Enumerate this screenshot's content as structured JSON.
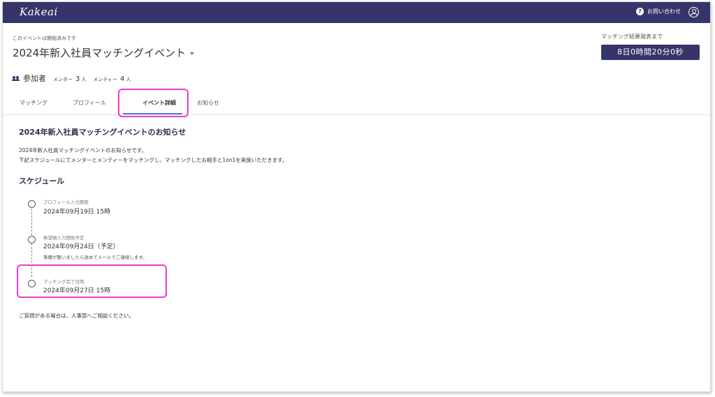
{
  "app": {
    "logo": "Kakeai"
  },
  "header": {
    "help_label": "お問い合わせ",
    "help_icon": "question-icon",
    "account_icon": "account-circle-icon"
  },
  "event": {
    "status_note": "このイベントは開始済みです",
    "title": "2024年新入社員マッチングイベント"
  },
  "countdown": {
    "label": "マッチング結果発表まで",
    "value": "8日0時間20分0秒"
  },
  "participants": {
    "label": "参加者",
    "mentor_label": "メンター",
    "mentor_count": "3",
    "mentor_unit": "人",
    "mentee_label": "メンティー",
    "mentee_count": "4",
    "mentee_unit": "人"
  },
  "tabs": [
    {
      "label": "マッチング"
    },
    {
      "label": "プロフィール"
    },
    {
      "label": "イベント詳細",
      "active": true
    },
    {
      "label": "お知らせ"
    }
  ],
  "notice": {
    "title": "2024年新入社員マッチングイベントのお知らせ",
    "line1": "2024年新入社員マッチングイベントのお知らせです。",
    "line2": "下記スケジュールにてメンターとメンティーをマッチングし、マッチングしたお相手と1on1を実施いただきます。"
  },
  "schedule": {
    "title": "スケジュール",
    "items": [
      {
        "caption": "プロフィール入力期限",
        "date": "2024年09月19日 15時",
        "note": ""
      },
      {
        "caption": "希望順入力開始予定",
        "date": "2024年09月24日（予定）",
        "note": "準備が整いましたら改めてメールでご連絡します。"
      },
      {
        "caption": "マッチング完了日時",
        "date": "2024年09月27日 15時",
        "note": ""
      }
    ]
  },
  "closing": "ご質問がある場合は、人事部へご相談ください。",
  "colors": {
    "nav": "#35356a",
    "accent": "#5b72c9",
    "highlight": "#e83cd1"
  }
}
